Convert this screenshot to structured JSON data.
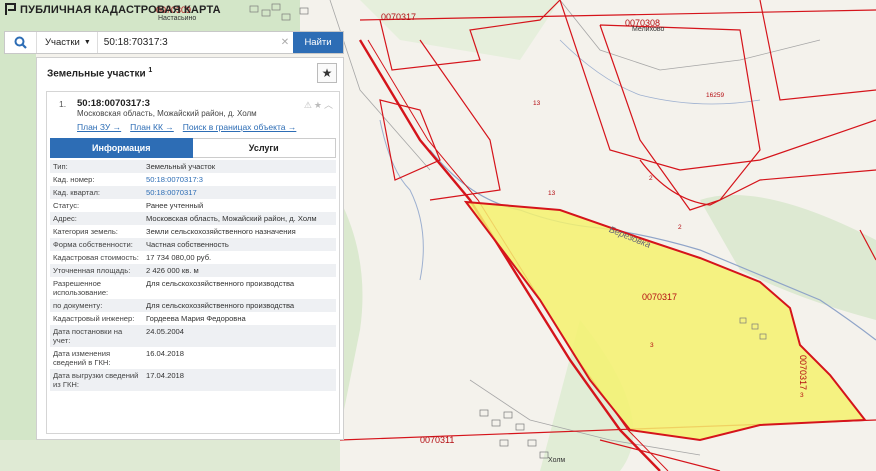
{
  "app": {
    "title": "ПУБЛИЧНАЯ КАДАСТРОВАЯ КАРТА"
  },
  "search": {
    "type_label": "Участки",
    "query": "50:18:70317:3",
    "find_label": "Найти"
  },
  "panel": {
    "title": "Земельные участки",
    "count": "1"
  },
  "card": {
    "number": "1.",
    "cadastral": "50:18:0070317:3",
    "address": "Московская область, Можайский район, д. Холм",
    "links": [
      "План ЗУ →",
      "План КК →",
      "Поиск в границах объекта →"
    ],
    "tabs": [
      "Информация",
      "Услуги"
    ]
  },
  "attributes": [
    {
      "key": "Тип:",
      "value": "Земельный участок"
    },
    {
      "key": "Кад. номер:",
      "value": "50:18:0070317:3"
    },
    {
      "key": "Кад. квартал:",
      "value": "50:18:0070317"
    },
    {
      "key": "Статус:",
      "value": "Ранее учтенный"
    },
    {
      "key": "Адрес:",
      "value": "Московская область, Можайский район, д. Холм"
    },
    {
      "key": "Категория земель:",
      "value": "Земли сельскохозяйственного назначения"
    },
    {
      "key": "Форма собственности:",
      "value": "Частная собственность"
    },
    {
      "key": "Кадастровая стоимость:",
      "value": "17 734 080,00 руб."
    },
    {
      "key": "Уточненная площадь:",
      "value": "2 426 000 кв. м"
    },
    {
      "key": "Разрешенное использование:",
      "value": "Для сельскохозяйственного производства"
    },
    {
      "key": "по документу:",
      "value": "Для сельскохозяйственного производства"
    },
    {
      "key": "Кадастровый инженер:",
      "value": "Гордеева Мария Федоровна"
    },
    {
      "key": "Дата постановки на учет:",
      "value": "24.05.2004"
    },
    {
      "key": "Дата изменения сведений в ГКН:",
      "value": "16.04.2018"
    },
    {
      "key": "Дата выгрузки сведений из ГКН:",
      "value": "17.04.2018"
    }
  ],
  "map_labels": {
    "q_0070309": "0070309",
    "q_0070317_top": "0070317",
    "q_0070308": "0070308",
    "q_0070317_main": "0070317",
    "q_0070311": "0070311",
    "q_0070317_side": "0070317",
    "v_nastasyino": "Настасьино",
    "v_melikhovo": "Мелихово",
    "v_kholm": "Холм",
    "river_berezovka": "Березовка",
    "p_16259": "16259",
    "p_13a": "13",
    "p_13b": "13",
    "p_2a": "2",
    "p_2b": "2",
    "p_3a": "3",
    "p_3b": "3"
  },
  "colors": {
    "accent": "#2d6db5",
    "boundary": "#d5141b",
    "selected_fill": "#f4f26e"
  }
}
